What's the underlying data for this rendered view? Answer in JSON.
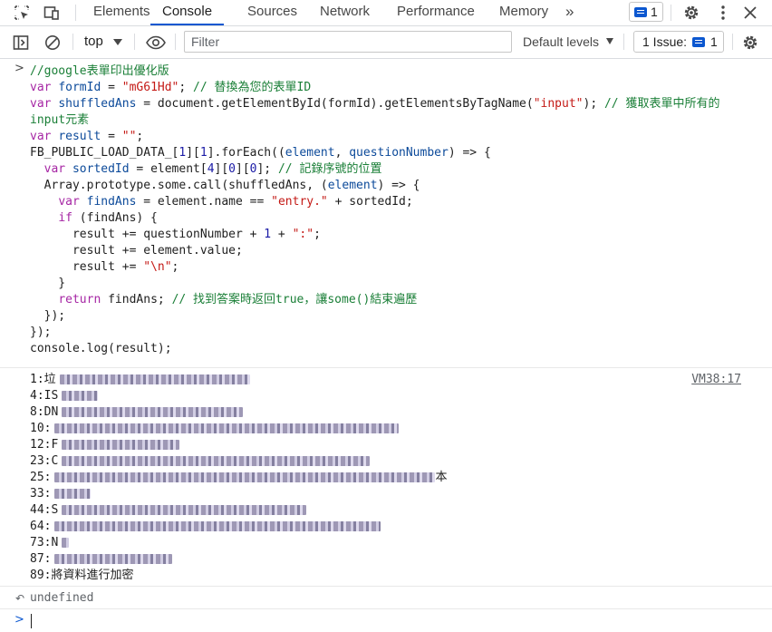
{
  "tabs": {
    "items": [
      "Elements",
      "Console",
      "Sources",
      "Network",
      "Performance",
      "Memory"
    ],
    "active": "Console",
    "more": "»",
    "message_count": "1"
  },
  "toolbar": {
    "context": "top",
    "filter_placeholder": "Filter",
    "levels": "Default levels",
    "issues_label": "1 Issue:",
    "issues_count": "1"
  },
  "console": {
    "source_link": "VM38:17",
    "output_lines": [
      {
        "prefix": "1:垃",
        "tail": ""
      },
      {
        "prefix": "4:IS",
        "tail": ""
      },
      {
        "prefix": "8:DN",
        "tail": ""
      },
      {
        "prefix": "10:",
        "tail": ""
      },
      {
        "prefix": "12:F",
        "tail": ""
      },
      {
        "prefix": "23:C",
        "tail": ""
      },
      {
        "prefix": "25:",
        "tail": "本"
      },
      {
        "prefix": "33:",
        "tail": ""
      },
      {
        "prefix": "44:S",
        "tail": ""
      },
      {
        "prefix": "64:",
        "tail": ""
      },
      {
        "prefix": "73:N",
        "tail": ""
      },
      {
        "prefix": "87:",
        "tail": ""
      },
      {
        "prefix": "89:將資料進行加密",
        "tail": ""
      }
    ],
    "return_value": "undefined"
  },
  "colors": {
    "accent": "#0b57d0",
    "keyword": "#a626a4",
    "string": "#c41a16",
    "comment": "#1a7f37"
  }
}
